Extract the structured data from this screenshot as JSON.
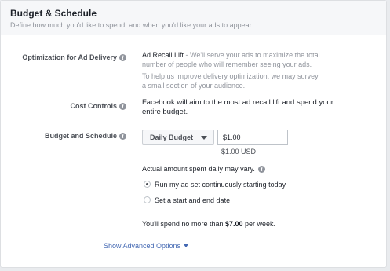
{
  "section": {
    "title": "Budget & Schedule",
    "subtitle": "Define how much you'd like to spend, and when you'd like your ads to appear."
  },
  "optimization": {
    "label": "Optimization for Ad Delivery",
    "value_title": "Ad Recall Lift",
    "value_desc_line1": " - We'll serve your ads to maximize the total",
    "value_desc_line2": "number of people who will remember seeing your ads.",
    "note_line1": "To help us improve delivery optimization, we may survey",
    "note_line2": "a small section of your audience."
  },
  "cost_controls": {
    "label": "Cost Controls",
    "text_line1": "Facebook will aim to the most ad recall lift and spend your",
    "text_line2": "entire budget."
  },
  "budget": {
    "label": "Budget and Schedule",
    "type_selected": "Daily Budget",
    "amount_value": "$1.00",
    "amount_hint": "$1.00 USD",
    "actual_note": "Actual amount spent daily may vary.",
    "schedule_options": [
      {
        "label": "Run my ad set continuously starting today",
        "selected": true
      },
      {
        "label": "Set a start and end date",
        "selected": false
      }
    ],
    "weekly_prefix": "You'll spend no more than ",
    "weekly_amount": "$7.00",
    "weekly_suffix": " per week."
  },
  "advanced_link": "Show Advanced Options",
  "icons": {
    "info": "info-icon",
    "dropdown": "caret-down-icon",
    "advanced": "chevron-down-icon"
  },
  "colors": {
    "link": "#4267b2",
    "muted": "#90949c",
    "text": "#1d2129"
  }
}
